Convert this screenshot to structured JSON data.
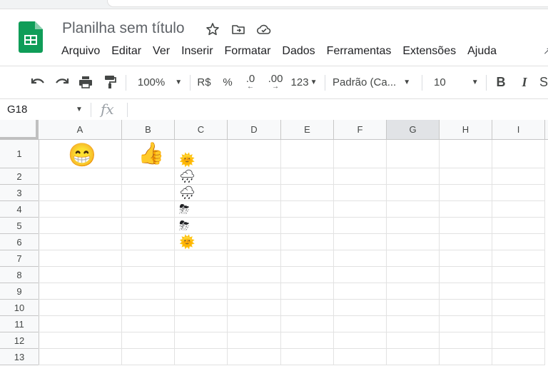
{
  "doc": {
    "title": "Planilha sem título"
  },
  "title_icons": [
    "star-icon",
    "move-folder-icon",
    "cloud-saved-icon"
  ],
  "menu": [
    "Arquivo",
    "Editar",
    "Ver",
    "Inserir",
    "Formatar",
    "Dados",
    "Ferramentas",
    "Extensões",
    "Ajuda"
  ],
  "toolbar": {
    "zoom": "100%",
    "currency": "R$",
    "percent": "%",
    "decrease_decimal": ".0",
    "increase_decimal": ".00",
    "more_formats": "123",
    "font": "Padrão (Ca...",
    "font_size": "10",
    "bold": "B",
    "italic": "I"
  },
  "formula_bar": {
    "cell_ref": "G18",
    "fx": "fx",
    "value": ""
  },
  "columns": [
    "A",
    "B",
    "C",
    "D",
    "E",
    "F",
    "G",
    "H",
    "I"
  ],
  "selected_column": "G",
  "rows": [
    "1",
    "2",
    "3",
    "4",
    "5",
    "6",
    "7",
    "8",
    "9",
    "10",
    "11",
    "12",
    "13"
  ],
  "cells": {
    "A1": "😁",
    "B1": "👍",
    "C1": "🌞",
    "C2": "🌧",
    "C3": "🌧",
    "C4": "⛈",
    "C5": "⛈",
    "C6": "🌞"
  },
  "colors": {
    "brand_green": "#0f9d58",
    "selected_header": "#e1e3e6"
  }
}
